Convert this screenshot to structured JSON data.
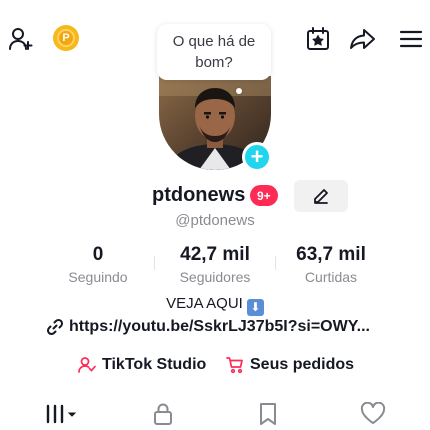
{
  "topbar": {
    "add_friend_icon": "person-plus-icon",
    "coin_letter": "P",
    "calendar_icon": "calendar-star-icon",
    "share_icon": "share-arrow-icon",
    "menu_icon": "hamburger-menu-icon"
  },
  "bubble": {
    "text": "O que há de bom?"
  },
  "profile": {
    "username": "ptdonews",
    "badge": "9+",
    "handle": "@ptdonews"
  },
  "stats": [
    {
      "value": "0",
      "label": "Seguindo"
    },
    {
      "value": "42,7 mil",
      "label": "Seguidores"
    },
    {
      "value": "63,7 mil",
      "label": "Curtidas"
    }
  ],
  "bio": {
    "line": "VEJA AQUI",
    "emoji": "⬇",
    "link": "https://youtu.be/SskrLJ37b5I?si=OWY..."
  },
  "shortcuts": {
    "studio": "TikTok Studio",
    "orders": "Seus pedidos"
  },
  "colors": {
    "accent": "#fe2c55",
    "cyan": "#20d5ec",
    "coin": "#f6b81b"
  }
}
